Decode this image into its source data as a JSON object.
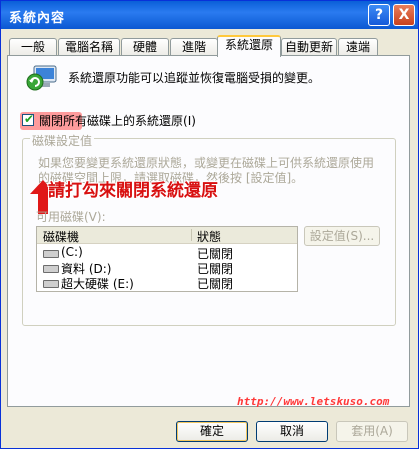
{
  "window": {
    "title": "系統內容",
    "help_label": "?",
    "close_label": "X"
  },
  "tabs": [
    {
      "label": "一般"
    },
    {
      "label": "電腦名稱"
    },
    {
      "label": "硬體"
    },
    {
      "label": "進階"
    },
    {
      "label": "系統還原"
    },
    {
      "label": "自動更新"
    },
    {
      "label": "遠端"
    }
  ],
  "system_restore": {
    "description": "系統還原功能可以追蹤並恢復電腦受損的變更。",
    "disable_checkbox": {
      "label_part1": "關閉所有",
      "label_part2": "磁碟上的系統還原(I)",
      "checked": true
    },
    "group_title": "磁碟設定值",
    "group_desc_line1": "如果您要變更系統還原狀態，或變更在磁碟上可供系統還原使用",
    "group_desc_line2": "的磁碟空間上限，請選取磁碟，然後按 [設定值]。",
    "available_label": "可用磁碟(V):",
    "columns": [
      "磁碟機",
      "狀態"
    ],
    "drives": [
      {
        "name": "(C:)",
        "status": "已關閉"
      },
      {
        "name": "資料 (D:)",
        "status": "已關閉"
      },
      {
        "name": "超大硬碟 (E:)",
        "status": "已關閉"
      }
    ],
    "settings_button": "設定值(S)..."
  },
  "annotation": {
    "text": "請打勾來關閉系統還原",
    "watermark": "http://www.letskuso.com",
    "accent": "#d81010"
  },
  "footer": {
    "ok": "確定",
    "cancel": "取消",
    "apply": "套用(A)"
  }
}
